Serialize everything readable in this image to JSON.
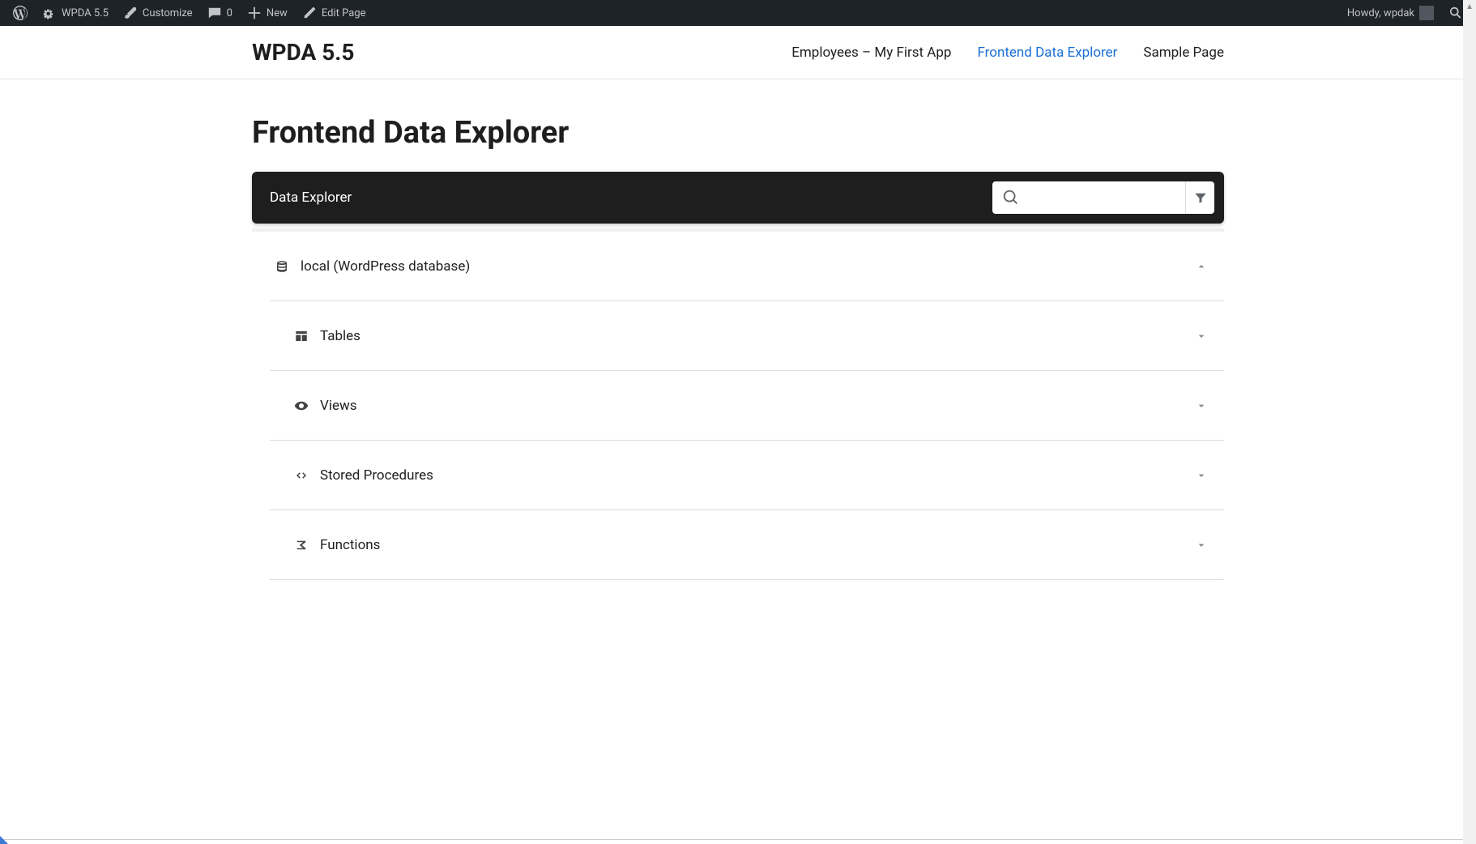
{
  "adminbar": {
    "site_name": "WPDA 5.5",
    "customize": "Customize",
    "comments_count": "0",
    "new": "New",
    "edit_page": "Edit Page",
    "howdy": "Howdy, wpdak"
  },
  "header": {
    "title": "WPDA 5.5",
    "nav": [
      {
        "label": "Employees – My First App",
        "current": false
      },
      {
        "label": "Frontend Data Explorer",
        "current": true
      },
      {
        "label": "Sample Page",
        "current": false
      }
    ]
  },
  "page": {
    "title": "Frontend Data Explorer"
  },
  "panel": {
    "title": "Data Explorer",
    "search_placeholder": ""
  },
  "tree": {
    "database": "local (WordPress database)",
    "sections": [
      {
        "icon": "tables-icon",
        "label": "Tables"
      },
      {
        "icon": "views-icon",
        "label": "Views"
      },
      {
        "icon": "proc-icon",
        "label": "Stored Procedures"
      },
      {
        "icon": "func-icon",
        "label": "Functions"
      }
    ]
  }
}
